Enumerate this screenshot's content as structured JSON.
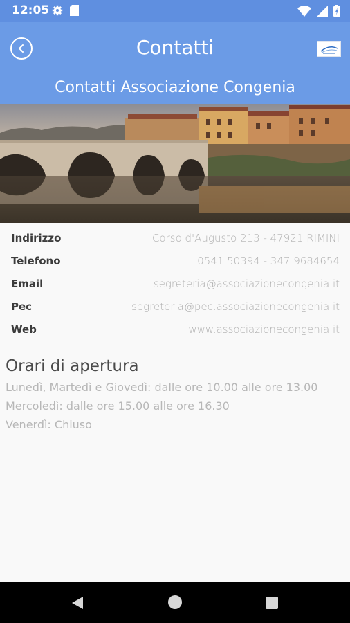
{
  "status_bar": {
    "time": "12:05",
    "icons": [
      "gear-icon",
      "sd-card-icon",
      "wifi-icon",
      "signal-icon",
      "battery-icon"
    ]
  },
  "header": {
    "title": "Contatti",
    "subtitle": "Contatti Associazione Congenia",
    "background_color": "#6b9be6"
  },
  "contacts": [
    {
      "label": "Indirizzo",
      "value": "Corso d'Augusto 213 - 47921 RIMINI"
    },
    {
      "label": "Telefono",
      "value": "0541 50394 - 347 9684654"
    },
    {
      "label": "Email",
      "value": "segreteria@associazionecongenia.it"
    },
    {
      "label": "Pec",
      "value": "segreteria@pec.associazionecongenia.it"
    },
    {
      "label": "Web",
      "value": "www.associazionecongenia.it"
    }
  ],
  "hours": {
    "title": "Orari di apertura",
    "lines": [
      "Lunedì, Martedì e Giovedì: dalle ore 10.00 alle ore 13.00",
      "Mercoledì: dalle ore 15.00 alle ore 16.30",
      "Venerdì: Chiuso"
    ]
  },
  "nav_bar": {
    "icons": [
      "back-triangle-icon",
      "home-circle-icon",
      "recents-square-icon"
    ]
  }
}
